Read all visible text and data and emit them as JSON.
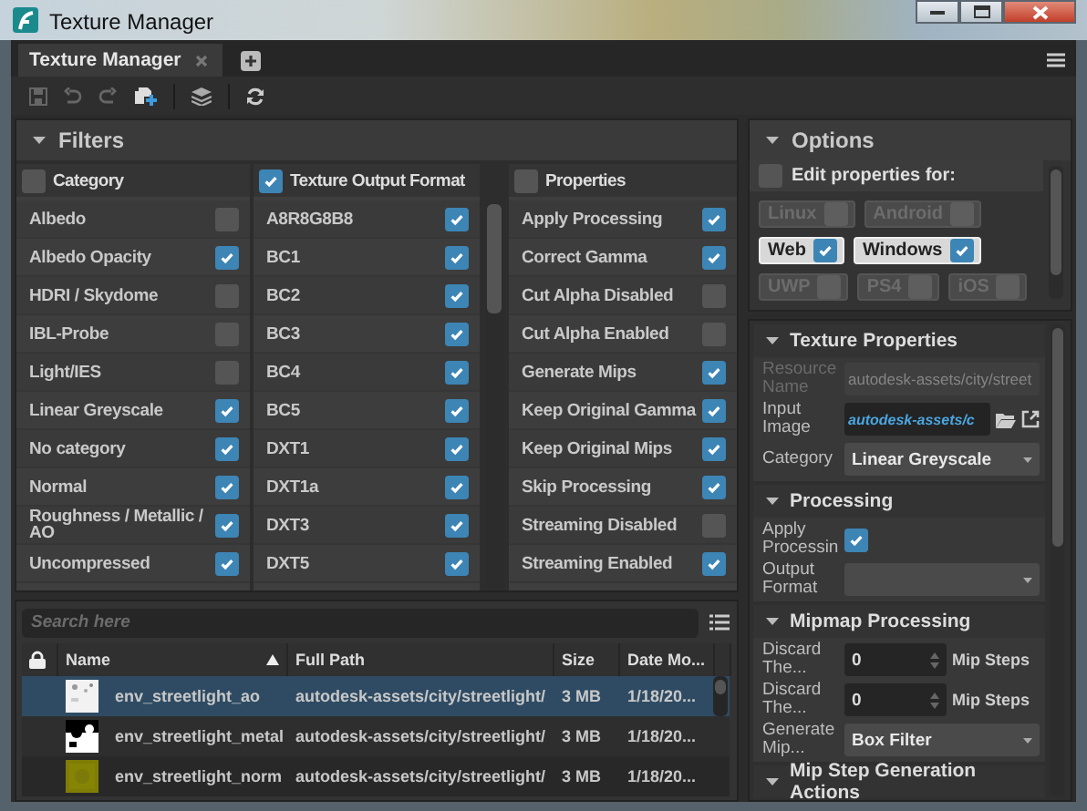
{
  "window": {
    "title": "Texture Manager"
  },
  "tabs": [
    {
      "label": "Texture Manager",
      "selected": true
    }
  ],
  "filters": {
    "title": "Filters",
    "expanded": true,
    "columns": [
      {
        "title": "Category",
        "checked": false,
        "items": [
          {
            "label": "Albedo",
            "checked": false
          },
          {
            "label": "Albedo Opacity",
            "checked": true
          },
          {
            "label": "HDRI / Skydome",
            "checked": false
          },
          {
            "label": "IBL-Probe",
            "checked": false
          },
          {
            "label": "Light/IES",
            "checked": false
          },
          {
            "label": "Linear Greyscale",
            "checked": true
          },
          {
            "label": "No category",
            "checked": true
          },
          {
            "label": "Normal",
            "checked": true
          },
          {
            "label": "Roughness / Metallic / AO",
            "checked": true
          },
          {
            "label": "Uncompressed",
            "checked": true
          }
        ]
      },
      {
        "title": "Texture Output Format",
        "checked": true,
        "items": [
          {
            "label": "A8R8G8B8",
            "checked": true
          },
          {
            "label": "BC1",
            "checked": true
          },
          {
            "label": "BC2",
            "checked": true
          },
          {
            "label": "BC3",
            "checked": true
          },
          {
            "label": "BC4",
            "checked": true
          },
          {
            "label": "BC5",
            "checked": true
          },
          {
            "label": "DXT1",
            "checked": true
          },
          {
            "label": "DXT1a",
            "checked": true
          },
          {
            "label": "DXT3",
            "checked": true
          },
          {
            "label": "DXT5",
            "checked": true
          }
        ]
      },
      {
        "title": "Properties",
        "checked": false,
        "items": [
          {
            "label": "Apply Processing",
            "checked": true
          },
          {
            "label": "Correct Gamma",
            "checked": true
          },
          {
            "label": "Cut Alpha Disabled",
            "checked": false
          },
          {
            "label": "Cut Alpha Enabled",
            "checked": false
          },
          {
            "label": "Generate Mips",
            "checked": true
          },
          {
            "label": "Keep Original Gamma",
            "checked": true
          },
          {
            "label": "Keep Original Mips",
            "checked": true
          },
          {
            "label": "Skip Processing",
            "checked": true
          },
          {
            "label": "Streaming Disabled",
            "checked": false
          },
          {
            "label": "Streaming Enabled",
            "checked": true
          }
        ]
      }
    ]
  },
  "assets": {
    "search": {
      "placeholder": "Search here"
    },
    "columns": [
      {
        "label": "Name",
        "sorted": true
      },
      {
        "label": "Full Path",
        "sorted": false
      },
      {
        "label": "Size",
        "sorted": false
      },
      {
        "label": "Date Mo...",
        "sorted": false
      }
    ],
    "rows": [
      {
        "name": "env_streetlight_ao",
        "path": "autodesk-assets/city/streetlight/",
        "size": "3 MB",
        "date": "1/18/20...",
        "selected": true
      },
      {
        "name": "env_streetlight_metal",
        "path": "autodesk-assets/city/streetlight/",
        "size": "3 MB",
        "date": "1/18/20...",
        "selected": false
      },
      {
        "name": "env_streetlight_norm",
        "path": "autodesk-assets/city/streetlight/",
        "size": "3 MB",
        "date": "1/18/20...",
        "selected": false
      }
    ]
  },
  "options": {
    "title": "Options",
    "expanded": true,
    "edit_for": {
      "label": "Edit properties for:",
      "checked": false
    },
    "platforms": [
      {
        "label": "Linux",
        "checked": false,
        "disabled": true
      },
      {
        "label": "Android",
        "checked": false,
        "disabled": true
      },
      {
        "label": "Web",
        "checked": true,
        "disabled": false
      },
      {
        "label": "Windows",
        "checked": true,
        "disabled": false
      },
      {
        "label": "UWP",
        "checked": false,
        "disabled": true
      },
      {
        "label": "PS4",
        "checked": false,
        "disabled": true
      },
      {
        "label": "iOS",
        "checked": false,
        "disabled": true
      }
    ]
  },
  "sections": [
    {
      "title": "Texture Properties",
      "expanded": true,
      "fields": [
        {
          "kind": "text",
          "label": "Resource Name",
          "value": "autodesk-assets/city/street",
          "disabled": true
        },
        {
          "kind": "file",
          "label": "Input Image",
          "value": "autodesk-assets/c"
        },
        {
          "kind": "dropdown",
          "label": "Category",
          "value": "Linear Greyscale"
        }
      ]
    },
    {
      "title": "Processing",
      "expanded": true,
      "fields": [
        {
          "kind": "checkbox",
          "label": "Apply Processin",
          "checked": true
        },
        {
          "kind": "dropdown",
          "label": "Output Format"
        }
      ]
    },
    {
      "title": "Mipmap Processing",
      "expanded": true,
      "fields": [
        {
          "kind": "spinner",
          "label": "Discard The...",
          "value": "0",
          "unit": "Mip Steps"
        },
        {
          "kind": "spinner",
          "label": "Discard The...",
          "value": "0",
          "unit": "Mip Steps"
        },
        {
          "kind": "dropdown",
          "label": "Generate Mip...",
          "value": "Box Filter"
        }
      ]
    },
    {
      "title": "Mip Step Generation Actions",
      "expanded": true
    }
  ]
}
